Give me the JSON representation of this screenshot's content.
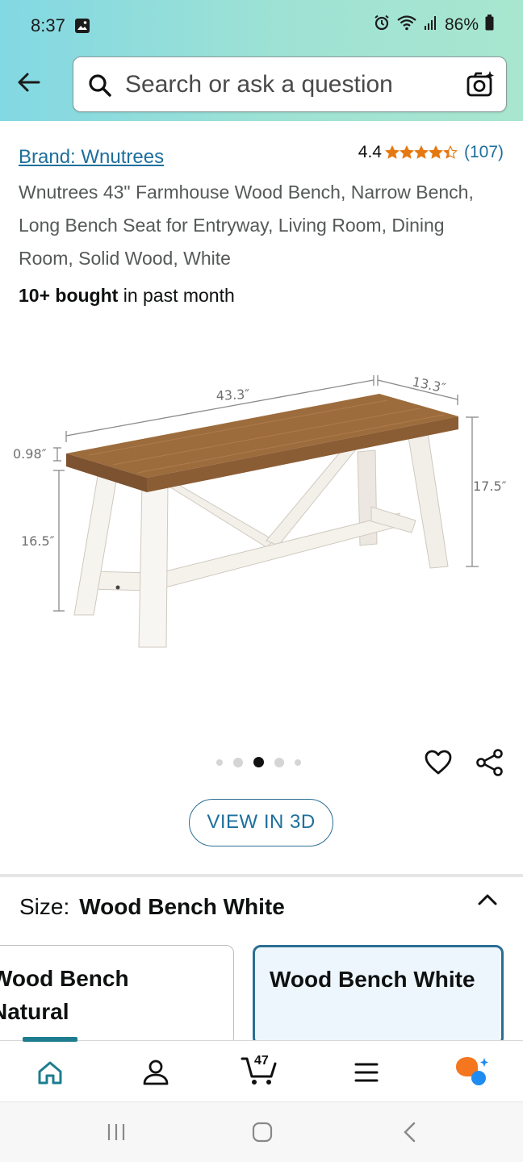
{
  "status_bar": {
    "time": "8:37",
    "battery": "86%"
  },
  "search": {
    "placeholder": "Search or ask a question"
  },
  "product": {
    "brand": "Brand: Wnutrees",
    "rating": "4.4",
    "stars": 4.4,
    "review_count": "(107)",
    "title": "Wnutrees 43\" Farmhouse Wood Bench, Narrow Bench, Long Bench Seat for Entryway, Living Room, Dining Room, Solid Wood, White",
    "bought_strong": "10+ bought",
    "bought_rest": " in past month"
  },
  "image": {
    "dims": {
      "length": "43.3″",
      "depth": "13.3″",
      "top_thickness": "0.98″",
      "height": "17.5″",
      "leg_height": "16.5″"
    },
    "carousel_index": 3,
    "carousel_count": 5
  },
  "view3d_label": "VIEW IN 3D",
  "size": {
    "label": "Size:",
    "selected": "Wood Bench White",
    "options": [
      {
        "line1": "Wood Bench",
        "line2": "Natural"
      },
      {
        "line1": "Wood Bench White"
      }
    ]
  },
  "nav": {
    "cart_count": "47"
  },
  "colors": {
    "accent": "#1d6f9c",
    "header_start": "#82d8e3",
    "header_end": "#a8e6cf",
    "star": "#e47911"
  },
  "icons": [
    "gallery-icon",
    "alarm-icon",
    "wifi-icon",
    "signal-icon",
    "battery-icon",
    "back-arrow-icon",
    "search-icon",
    "camera-icon",
    "heart-icon",
    "share-icon",
    "chevron-up-icon",
    "home-icon",
    "account-icon",
    "cart-icon",
    "menu-icon",
    "rufus-icon"
  ]
}
